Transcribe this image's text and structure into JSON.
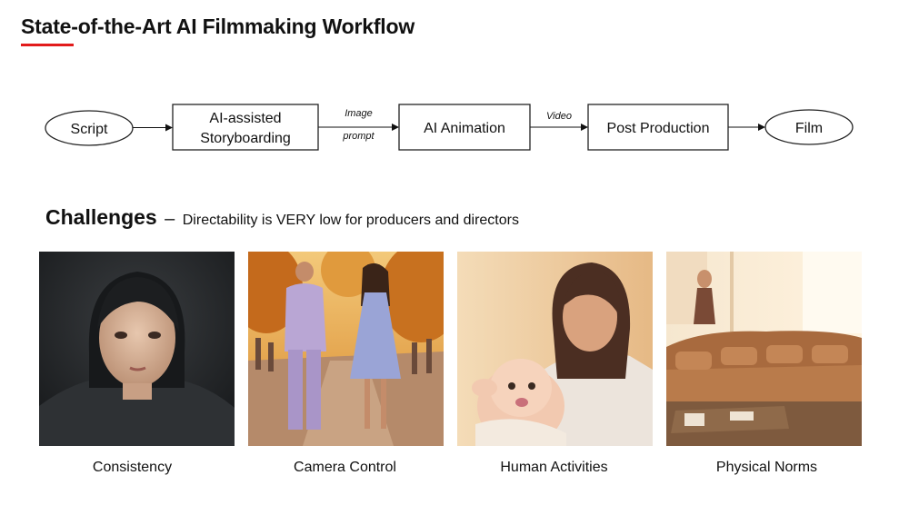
{
  "title": "State-of-the-Art AI Filmmaking Workflow",
  "accent_color": "#e21b1b",
  "workflow": {
    "nodes": [
      {
        "id": "script",
        "shape": "ellipse",
        "lines": [
          "Script"
        ]
      },
      {
        "id": "storyboard",
        "shape": "rect",
        "lines": [
          "AI-assisted",
          "Storyboarding"
        ]
      },
      {
        "id": "animation",
        "shape": "rect",
        "lines": [
          "AI Animation"
        ]
      },
      {
        "id": "post",
        "shape": "rect",
        "lines": [
          "Post Production"
        ]
      },
      {
        "id": "film",
        "shape": "ellipse",
        "lines": [
          "Film"
        ]
      }
    ],
    "edges": [
      {
        "from": "script",
        "to": "storyboard",
        "label": []
      },
      {
        "from": "storyboard",
        "to": "animation",
        "label": [
          "Image",
          "prompt"
        ]
      },
      {
        "from": "animation",
        "to": "post",
        "label": [
          "Video"
        ]
      },
      {
        "from": "post",
        "to": "film",
        "label": []
      }
    ]
  },
  "challenges": {
    "heading": "Challenges",
    "dash": "–",
    "subtitle": "Directability is VERY low for producers and directors",
    "items": [
      {
        "caption": "Consistency",
        "image": "portrait-woman-photo"
      },
      {
        "caption": "Camera Control",
        "image": "couple-walking-photo"
      },
      {
        "caption": "Human Activities",
        "image": "mother-baby-photo"
      },
      {
        "caption": "Physical Norms",
        "image": "living-room-sofa-photo"
      }
    ]
  }
}
